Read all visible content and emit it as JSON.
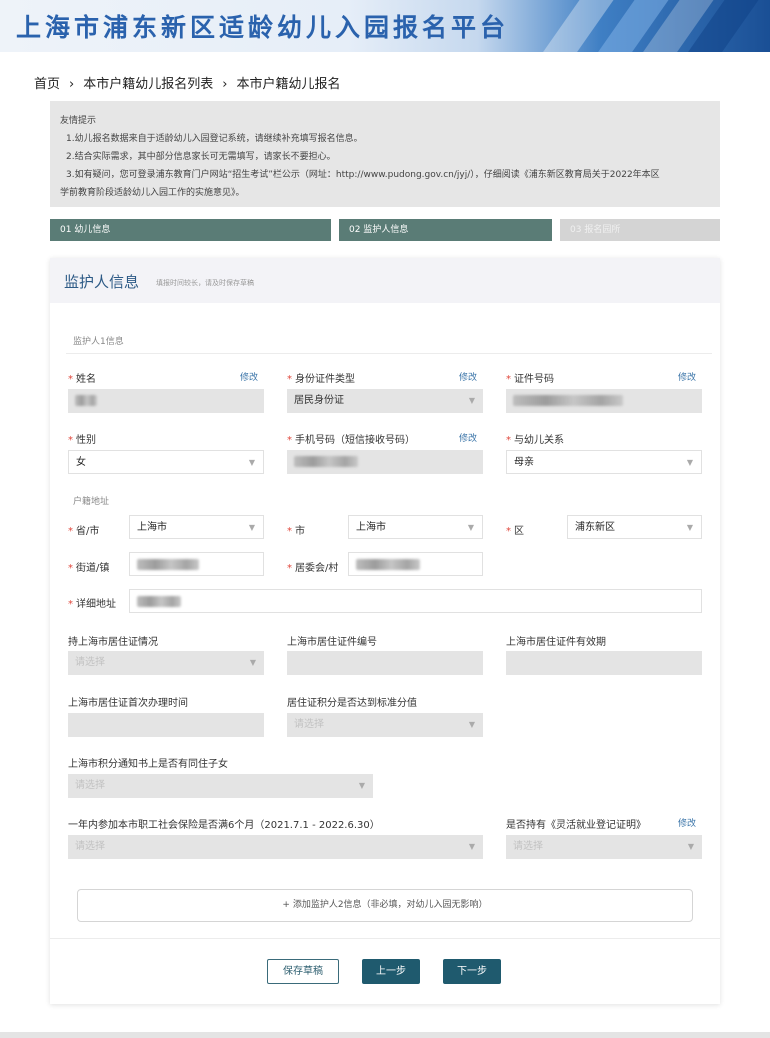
{
  "banner": {
    "title": "上海市浦东新区适龄幼儿入园报名平台"
  },
  "breadcrumb": {
    "home": "首页",
    "list": "本市户籍幼儿报名列表",
    "current": "本市户籍幼儿报名",
    "separator": "›"
  },
  "tips": {
    "title": "友情提示",
    "line1": "1.幼儿报名数据来自于适龄幼儿入园登记系统，请继续补充填写报名信息。",
    "line2": "2.结合实际需求，其中部分信息家长可无需填写，请家长不要担心。",
    "line3a": "3.如有疑问，您可登录浦东教育门户网站“招生考试”栏公示（网址：http://www.pudong.gov.cn/jyj/），仔细阅读《浦东新区教育局关于2022年本区",
    "line3b": "学前教育阶段适龄幼儿入园工作的实施意见》。"
  },
  "steps": [
    {
      "label": "01 幼儿信息",
      "state": "done"
    },
    {
      "label": "02 监护人信息",
      "state": "active"
    },
    {
      "label": "03 报名园所",
      "state": "pending"
    }
  ],
  "form": {
    "title": "监护人信息",
    "subtitle": "填报时间较长，请及时保存草稿",
    "section1": "监护人1信息",
    "name": {
      "label": "姓名",
      "edit": "修改"
    },
    "id_type": {
      "label": "身份证件类型",
      "value": "居民身份证",
      "edit": "修改"
    },
    "id_number": {
      "label": "证件号码",
      "edit": "修改"
    },
    "gender": {
      "label": "性别",
      "value": "女"
    },
    "phone": {
      "label": "手机号码（短信接收号码）",
      "edit": "修改"
    },
    "relation": {
      "label": "与幼儿关系",
      "value": "母亲"
    },
    "hukou_section": "户籍地址",
    "province": {
      "label": "省/市",
      "value": "上海市"
    },
    "city": {
      "label": "市",
      "value": "上海市"
    },
    "district": {
      "label": "区",
      "value": "浦东新区"
    },
    "street": {
      "label": "街道/镇"
    },
    "committee": {
      "label": "居委会/村"
    },
    "detail_address": {
      "label": "详细地址"
    },
    "residence_permit": {
      "label": "持上海市居住证情况",
      "placeholder": "请选择"
    },
    "residence_permit_no": {
      "label": "上海市居住证件编号"
    },
    "residence_permit_validity": {
      "label": "上海市居住证件有效期"
    },
    "residence_first_date": {
      "label": "上海市居住证首次办理时间"
    },
    "residence_points": {
      "label": "居住证积分是否达到标准分值",
      "placeholder": "请选择"
    },
    "points_notice": {
      "label": "上海市积分通知书上是否有同住子女",
      "placeholder": "请选择"
    },
    "social_insurance": {
      "label": "一年内参加本市职工社会保险是否满6个月（2021.7.1 - 2022.6.30）",
      "placeholder": "请选择"
    },
    "flexible_employment": {
      "label": "是否持有《灵活就业登记证明》",
      "placeholder": "请选择",
      "edit": "修改"
    },
    "add_guardian2": "+ 添加监护人2信息（非必填，对幼儿入园无影响）"
  },
  "actions": {
    "save_draft": "保存草稿",
    "prev": "上一步",
    "next": "下一步"
  },
  "colors": {
    "step_active": "#5a7c76",
    "primary_button": "#1f5a6e",
    "required": "#e0473c",
    "link": "#3a74a8"
  }
}
